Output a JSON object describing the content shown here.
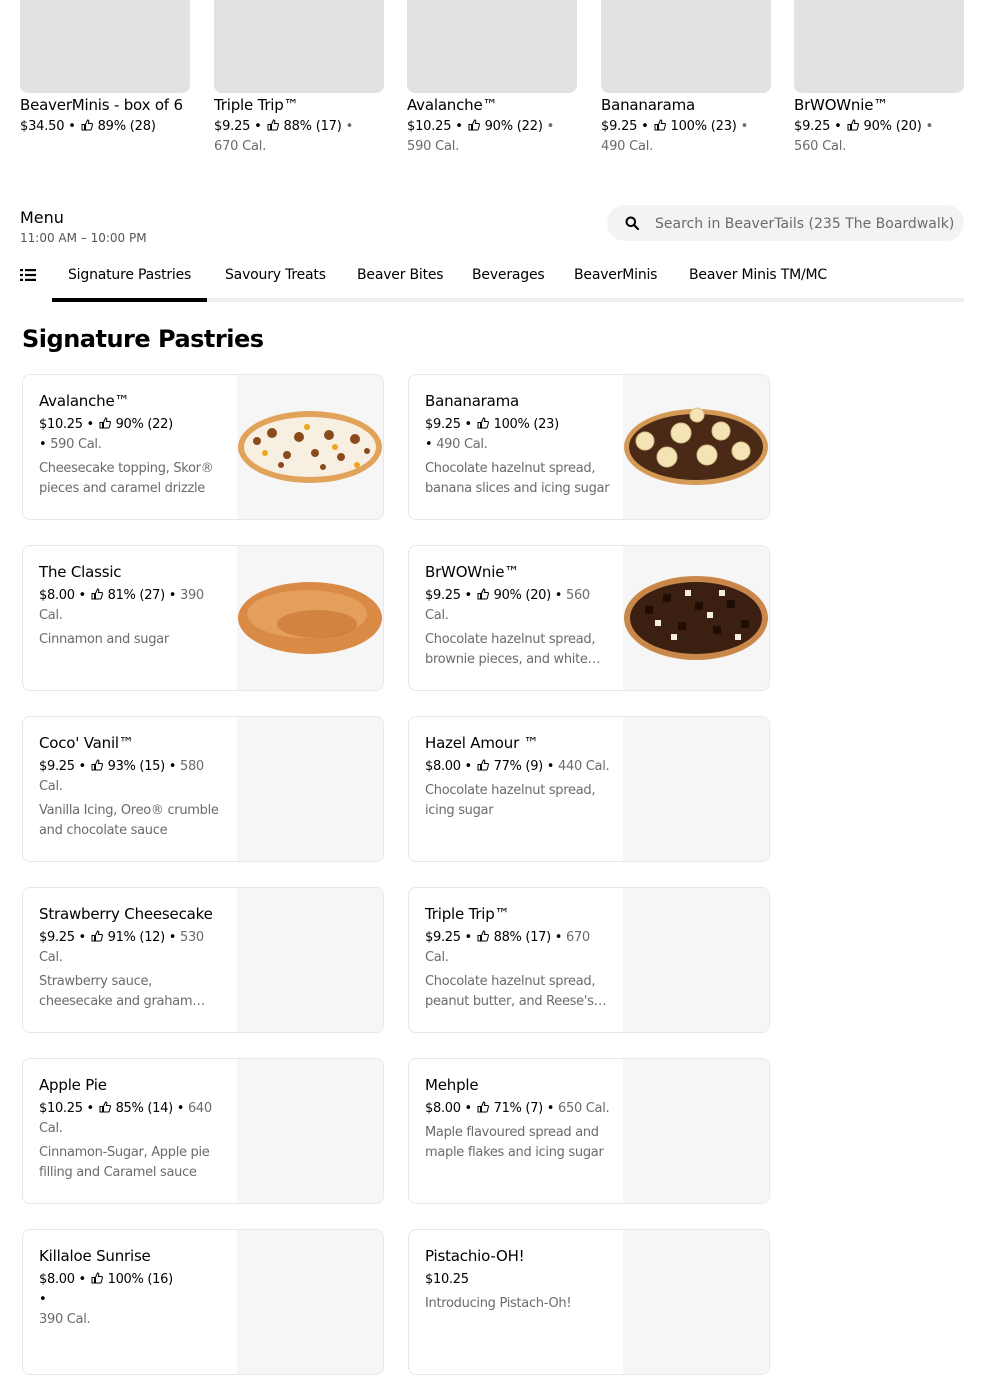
{
  "featured": [
    {
      "name": "BeaverMinis - box of 6",
      "price": "$34.50",
      "rating": "89% (28)",
      "calories": ""
    },
    {
      "name": "Triple Trip™",
      "price": "$9.25",
      "rating": "88% (17)",
      "calories": "670 Cal."
    },
    {
      "name": "Avalanche™",
      "price": "$10.25",
      "rating": "90% (22)",
      "calories": "590 Cal."
    },
    {
      "name": "Bananarama",
      "price": "$9.25",
      "rating": "100% (23)",
      "calories": "490 Cal."
    },
    {
      "name": "BrWOWnie™",
      "price": "$9.25",
      "rating": "90% (20)",
      "calories": "560 Cal."
    }
  ],
  "menu": {
    "title": "Menu",
    "hours": "11:00 AM – 10:00 PM"
  },
  "search": {
    "placeholder": "Search in BeaverTails (235 The Boardwalk)"
  },
  "tabs": [
    "Signature Pastries",
    "Savoury Treats",
    "Beaver Bites",
    "Beverages",
    "BeaverMinis",
    "Beaver Minis TM/MC"
  ],
  "section": {
    "title": "Signature Pastries"
  },
  "items": [
    {
      "name": "Avalanche™",
      "price": "$10.25",
      "rating": "90% (22)",
      "calories": "590 Cal.",
      "description": "Cheesecake topping, Skor® pieces and caramel drizzle"
    },
    {
      "name": "Bananarama",
      "price": "$9.25",
      "rating": "100% (23)",
      "calories": "490 Cal.",
      "description": "Chocolate hazelnut spread, banana slices and icing sugar"
    },
    {
      "name": "The Classic",
      "price": "$8.00",
      "rating": "81% (27)",
      "calories": "390 Cal.",
      "description": "Cinnamon and sugar"
    },
    {
      "name": "BrWOWnie™",
      "price": "$9.25",
      "rating": "90% (20)",
      "calories": "560 Cal.",
      "description": "Chocolate hazelnut spread, brownie pieces, and white chocolate chips"
    },
    {
      "name": "Coco' Vanil™",
      "price": "$9.25",
      "rating": "93% (15)",
      "calories": "580 Cal.",
      "description": "Vanilla Icing, Oreo® crumble and chocolate sauce"
    },
    {
      "name": "Hazel Amour ™",
      "price": "$8.00",
      "rating": "77% (9)",
      "calories": "440 Cal.",
      "description": "Chocolate hazelnut spread, icing sugar"
    },
    {
      "name": "Strawberry Cheesecake",
      "price": "$9.25",
      "rating": "91% (12)",
      "calories": "530 Cal.",
      "description": "Strawberry sauce, cheesecake and graham crumble"
    },
    {
      "name": "Triple Trip™",
      "price": "$9.25",
      "rating": "88% (17)",
      "calories": "670 Cal.",
      "description": "Chocolate hazelnut spread, peanut butter, and Reese's Pieces"
    },
    {
      "name": "Apple Pie",
      "price": "$10.25",
      "rating": "85% (14)",
      "calories": "640 Cal.",
      "description": "Cinnamon-Sugar, Apple pie filling and Caramel sauce"
    },
    {
      "name": "Mehple",
      "price": "$8.00",
      "rating": "71% (7)",
      "calories": "650 Cal.",
      "description": "Maple flavoured spread and maple flakes and icing sugar"
    },
    {
      "name": "Killaloe Sunrise",
      "price": "$8.00",
      "rating": "100% (16)",
      "calories": "390 Cal.",
      "description": ""
    },
    {
      "name": "Pistachio-OH!",
      "price": "$10.25",
      "rating": "",
      "calories": "",
      "description": "Introducing Pistach-Oh!"
    }
  ],
  "colors": {
    "accent": "#000000",
    "muted": "#6b6b6b",
    "placeholder_bg": "#e2e2e2"
  }
}
